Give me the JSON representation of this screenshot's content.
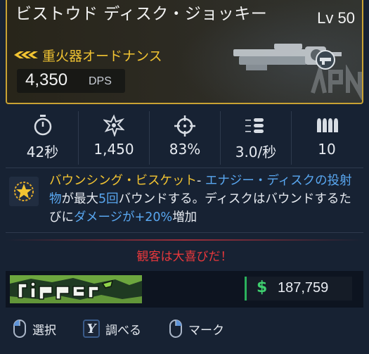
{
  "weapon": {
    "name": "ビストウド ディスク・ジョッキー",
    "level": "Lv 50",
    "type": "重火器オードナンス",
    "dps_value": "4,350",
    "dps_unit": "DPS",
    "rarity_color": "#f2c432"
  },
  "stats": [
    {
      "icon": "stopwatch-icon",
      "value": "42秒"
    },
    {
      "icon": "impact-burst-icon",
      "value": "1,450"
    },
    {
      "icon": "crosshair-icon",
      "value": "83%"
    },
    {
      "icon": "fire-rate-icon",
      "value": "3.0/秒"
    },
    {
      "icon": "ammo-icon",
      "value": "10"
    }
  ],
  "perk": {
    "icon": "star-badge-icon",
    "name": "バウンシング・ビスケット",
    "sep": "- ",
    "t1": "エナジー・ディスクの投射物",
    "t2": "が最大",
    "t3": "5回",
    "t4": "バウンドする。ディスクはバウンドするたびに",
    "t5": "ダメージが+20%",
    "t6": "増加"
  },
  "flavor_text": "観客は大喜びだ！",
  "manufacturer": {
    "logo": "ripper-logo-icon"
  },
  "price": {
    "currency_symbol": "$",
    "value": "187,759"
  },
  "controls": [
    {
      "icon": "mouse-left-icon",
      "label": "選択"
    },
    {
      "icon": "y-button-icon",
      "key": "Y",
      "label": "調べる"
    },
    {
      "icon": "mouse-right-icon",
      "label": "マーク"
    }
  ],
  "colors": {
    "accent_gold": "#c9a233",
    "highlight_blue": "#59a7f0",
    "flavor_red": "#e8383c",
    "money_green": "#3fd06f"
  }
}
